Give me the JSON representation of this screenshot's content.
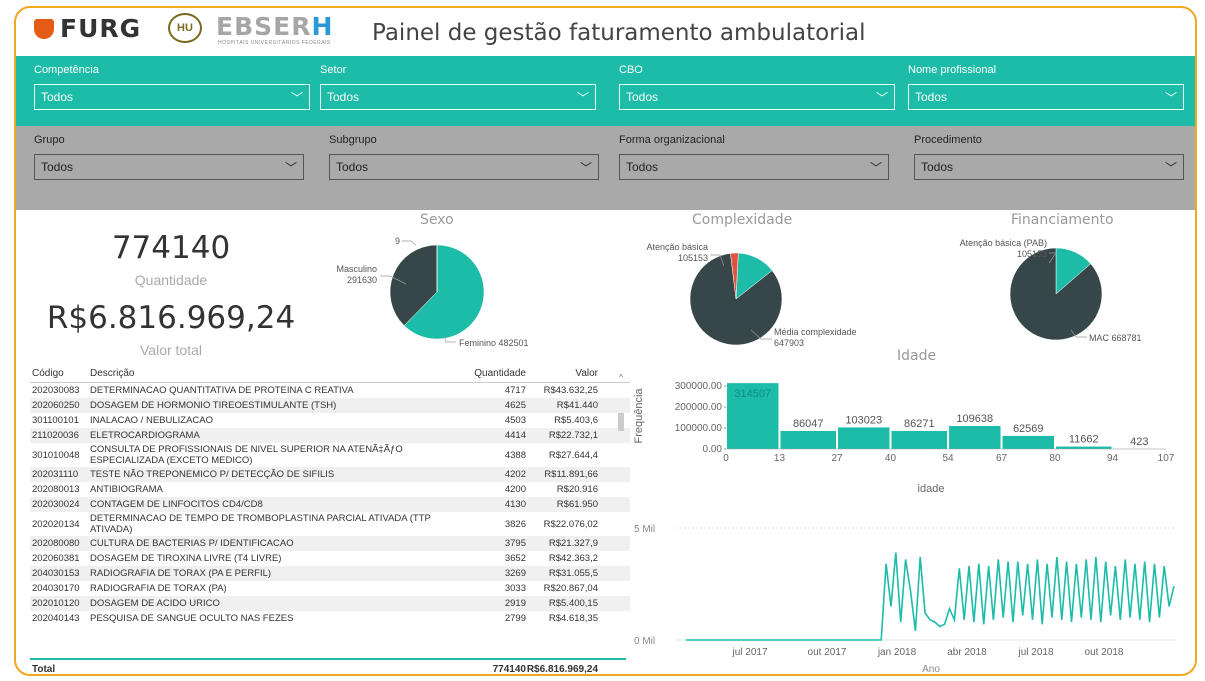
{
  "header": {
    "logo_furg": "FURG",
    "logo_hu": "HU",
    "logo_ebserh_1": "EBSER",
    "logo_ebserh_2": "H",
    "logo_ebserh_sub": "HOSPITAIS UNIVERSITÁRIOS FEDERAIS",
    "title": "Painel de gestão faturamento ambulatorial"
  },
  "filters_row1": [
    {
      "label": "Competência",
      "value": "Todos"
    },
    {
      "label": "Setor",
      "value": "Todos"
    },
    {
      "label": "CBO",
      "value": "Todos"
    },
    {
      "label": "Nome profissional",
      "value": "Todos"
    }
  ],
  "filters_row2": [
    {
      "label": "Grupo",
      "value": "Todos"
    },
    {
      "label": "Subgrupo",
      "value": "Todos"
    },
    {
      "label": "Forma organizacional",
      "value": "Todos"
    },
    {
      "label": "Procedimento",
      "value": "Todos"
    }
  ],
  "kpis": {
    "quantidade_value": "774140",
    "quantidade_label": "Quantidade",
    "valor_value": "R$6.816.969,24",
    "valor_label": "Valor total"
  },
  "colors": {
    "teal": "#1cbca8",
    "dark": "#374649",
    "red": "#e0533f",
    "orange_border": "#f0a81e"
  },
  "pies": {
    "sexo": {
      "title": "Sexo",
      "labels": [
        "9",
        "Masculino",
        "291630",
        "Feminino 482501"
      ]
    },
    "complexidade": {
      "title": "Complexidade",
      "labels": [
        "Atenção básica",
        "105153",
        "Média complexidade",
        "647903"
      ]
    },
    "financiamento": {
      "title": "Financiamento",
      "labels": [
        "Atenção básica (PAB)",
        "105153",
        "MAC 668781"
      ]
    }
  },
  "table": {
    "headers": [
      "Código",
      "Descrição",
      "Quantidade",
      "Valor"
    ],
    "rows": [
      [
        "202030083",
        "DETERMINACAO QUANTITATIVA DE PROTEINA C REATIVA",
        "4717",
        "R$43.632,25"
      ],
      [
        "202060250",
        "DOSAGEM DE HORMONIO TIREOESTIMULANTE (TSH)",
        "4625",
        "R$41.440"
      ],
      [
        "301100101",
        "INALACAO / NEBULIZACAO",
        "4503",
        "R$5.403,6"
      ],
      [
        "211020036",
        "ELETROCARDIOGRAMA",
        "4414",
        "R$22.732,1"
      ],
      [
        "301010048",
        "CONSULTA DE PROFISSIONAIS DE NIVEL SUPERIOR NA ATENÃ‡ÃƒO ESPECIALIZADA (EXCETO MEDICO)",
        "4388",
        "R$27.644,4"
      ],
      [
        "202031110",
        "TESTE NÃO TREPONEMICO P/ DETECÇÃO DE SIFILIS",
        "4202",
        "R$11.891,66"
      ],
      [
        "202080013",
        "ANTIBIOGRAMA",
        "4200",
        "R$20.916"
      ],
      [
        "202030024",
        "CONTAGEM DE LINFOCITOS CD4/CD8",
        "4130",
        "R$61.950"
      ],
      [
        "202020134",
        "DETERMINACAO DE TEMPO DE TROMBOPLASTINA PARCIAL ATIVADA (TTP ATIVADA)",
        "3826",
        "R$22.076,02"
      ],
      [
        "202080080",
        "CULTURA DE BACTERIAS P/ IDENTIFICACAO",
        "3795",
        "R$21.327,9"
      ],
      [
        "202060381",
        "DOSAGEM DE TIROXINA LIVRE (T4 LIVRE)",
        "3652",
        "R$42.363,2"
      ],
      [
        "204030153",
        "RADIOGRAFIA DE TORAX (PA E PERFIL)",
        "3269",
        "R$31.055,5"
      ],
      [
        "204030170",
        "RADIOGRAFIA DE TORAX (PA)",
        "3033",
        "R$20.867,04"
      ],
      [
        "202010120",
        "DOSAGEM DE ACIDO URICO",
        "2919",
        "R$5.400,15"
      ],
      [
        "202040143",
        "PESQUISA DE SANGUE OCULTO NAS FEZES",
        "2799",
        "R$4.618,35"
      ]
    ],
    "total": [
      "Total",
      "774140",
      "R$6.816.969,24"
    ]
  },
  "chart_data": [
    {
      "type": "pie",
      "title": "Sexo",
      "categories": [
        "Feminino",
        "Masculino",
        "(sem rótulo)"
      ],
      "values": [
        482501,
        291630,
        9
      ]
    },
    {
      "type": "pie",
      "title": "Complexidade",
      "categories": [
        "Média complexidade",
        "Atenção básica",
        "(sem rótulo)"
      ],
      "values": [
        647903,
        105153,
        21084
      ]
    },
    {
      "type": "pie",
      "title": "Financiamento",
      "categories": [
        "MAC",
        "Atenção básica (PAB)"
      ],
      "values": [
        668781,
        105153
      ]
    },
    {
      "type": "bar",
      "title": "Idade",
      "xlabel": "idade",
      "ylabel": "Frequência",
      "bins": [
        0,
        13,
        27,
        40,
        54,
        67,
        80,
        94,
        107
      ],
      "x_ticks": [
        "0",
        "13",
        "27",
        "40",
        "54",
        "67",
        "80",
        "94",
        "107"
      ],
      "y_ticks": [
        "0.00",
        "100000.00",
        "200000.00",
        "300000.00"
      ],
      "values": [
        314507,
        86047,
        103023,
        86271,
        109638,
        62569,
        11662,
        423
      ],
      "value_labels": [
        "314507",
        "86047",
        "103023",
        "86271",
        "109638",
        "62569",
        "11662",
        "423"
      ],
      "ylim": [
        0,
        320000
      ]
    },
    {
      "type": "line",
      "title": "",
      "xlabel": "Ano",
      "ylabel": "",
      "y_ticks": [
        "0 Mil",
        "5 Mil"
      ],
      "x_ticks": [
        "jul 2017",
        "out 2017",
        "jan 2018",
        "abr 2018",
        "jul 2018",
        "out 2018"
      ],
      "ylim": [
        0,
        5000
      ],
      "series": [
        {
          "values": [
            0,
            0,
            0,
            0,
            0,
            0,
            0,
            0,
            0,
            0,
            0,
            0,
            0,
            0,
            0,
            0,
            0,
            0,
            0,
            0,
            0,
            0,
            0,
            0,
            0,
            0,
            0,
            0,
            0,
            0,
            0,
            0,
            0,
            0,
            0,
            0,
            0,
            0,
            0,
            0,
            0,
            3400,
            1500,
            3900,
            800,
            3600,
            2200,
            400,
            3700,
            1200,
            900,
            800,
            600,
            700,
            1400,
            900,
            3200,
            900,
            3300,
            800,
            3400,
            700,
            3300,
            900,
            3600,
            1000,
            3500,
            800,
            3500,
            1100,
            3400,
            900,
            3600,
            700,
            3400,
            1000,
            3700,
            900,
            3500,
            800,
            3400,
            1000,
            3600,
            900,
            3700,
            800,
            3500,
            1100,
            3300,
            900,
            3600,
            1000,
            3400,
            900,
            3500,
            800,
            3400,
            1000,
            3300,
            1500,
            2400
          ]
        }
      ]
    }
  ]
}
